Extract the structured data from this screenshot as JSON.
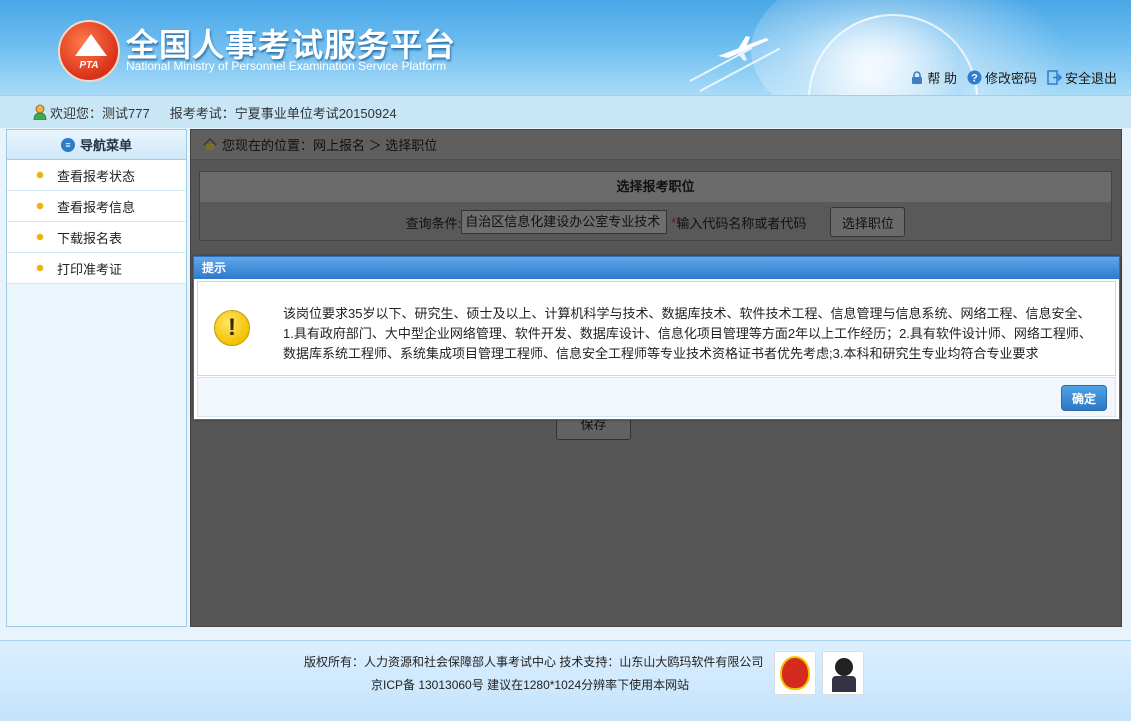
{
  "header": {
    "logo_text": "PTA",
    "title": "全国人事考试服务平台",
    "subtitle": "National Ministry of Personnel Examination Service Platform",
    "actions": {
      "help": "帮 助",
      "change_password": "修改密码",
      "logout": "安全退出"
    }
  },
  "userbar": {
    "welcome": "欢迎您：测试777",
    "exam": "报考考试：宁夏事业单位考试20150924"
  },
  "sidebar": {
    "title": "导航菜单",
    "items": [
      {
        "label": "查看报考状态"
      },
      {
        "label": "查看报考信息"
      },
      {
        "label": "下载报名表"
      },
      {
        "label": "打印准考证"
      }
    ]
  },
  "breadcrumb": "您现在的位置：网上报名 ＞ 选择职位",
  "form": {
    "title": "选择报考职位",
    "query_label": "查询条件:",
    "query_value": "自治区信息化建设办公室专业技术",
    "required_mark": "*",
    "hint": "输入代码名称或者代码",
    "select_button": "选择职位",
    "save_button": "保存"
  },
  "modal": {
    "title": "提示",
    "message": "该岗位要求35岁以下、研究生、硕士及以上、计算机科学与技术、数据库技术、软件技术工程、信息管理与信息系统、网络工程、信息安全、1.具有政府部门、大中型企业网络管理、软件开发、数据库设计、信息化项目管理等方面2年以上工作经历；2.具有软件设计师、网络工程师、数据库系统工程师、系统集成项目管理工程师、信息安全工程师等专业技术资格证书者优先考虑;3.本科和研究生专业均符合专业要求",
    "ok_button": "确定"
  },
  "footer": {
    "line1": "版权所有：人力资源和社会保障部人事考试中心  技术支持：山东山大鸥玛软件有限公司",
    "line2": "京ICP备 13013060号  建议在1280*1024分辨率下使用本网站"
  },
  "colors": {
    "header_blue": "#4aa6e6",
    "dialog_header": "#2f79cc",
    "ok_button": "#2d78c6",
    "menu_dot": "#f0b400",
    "overlay_gray": "#565656"
  }
}
